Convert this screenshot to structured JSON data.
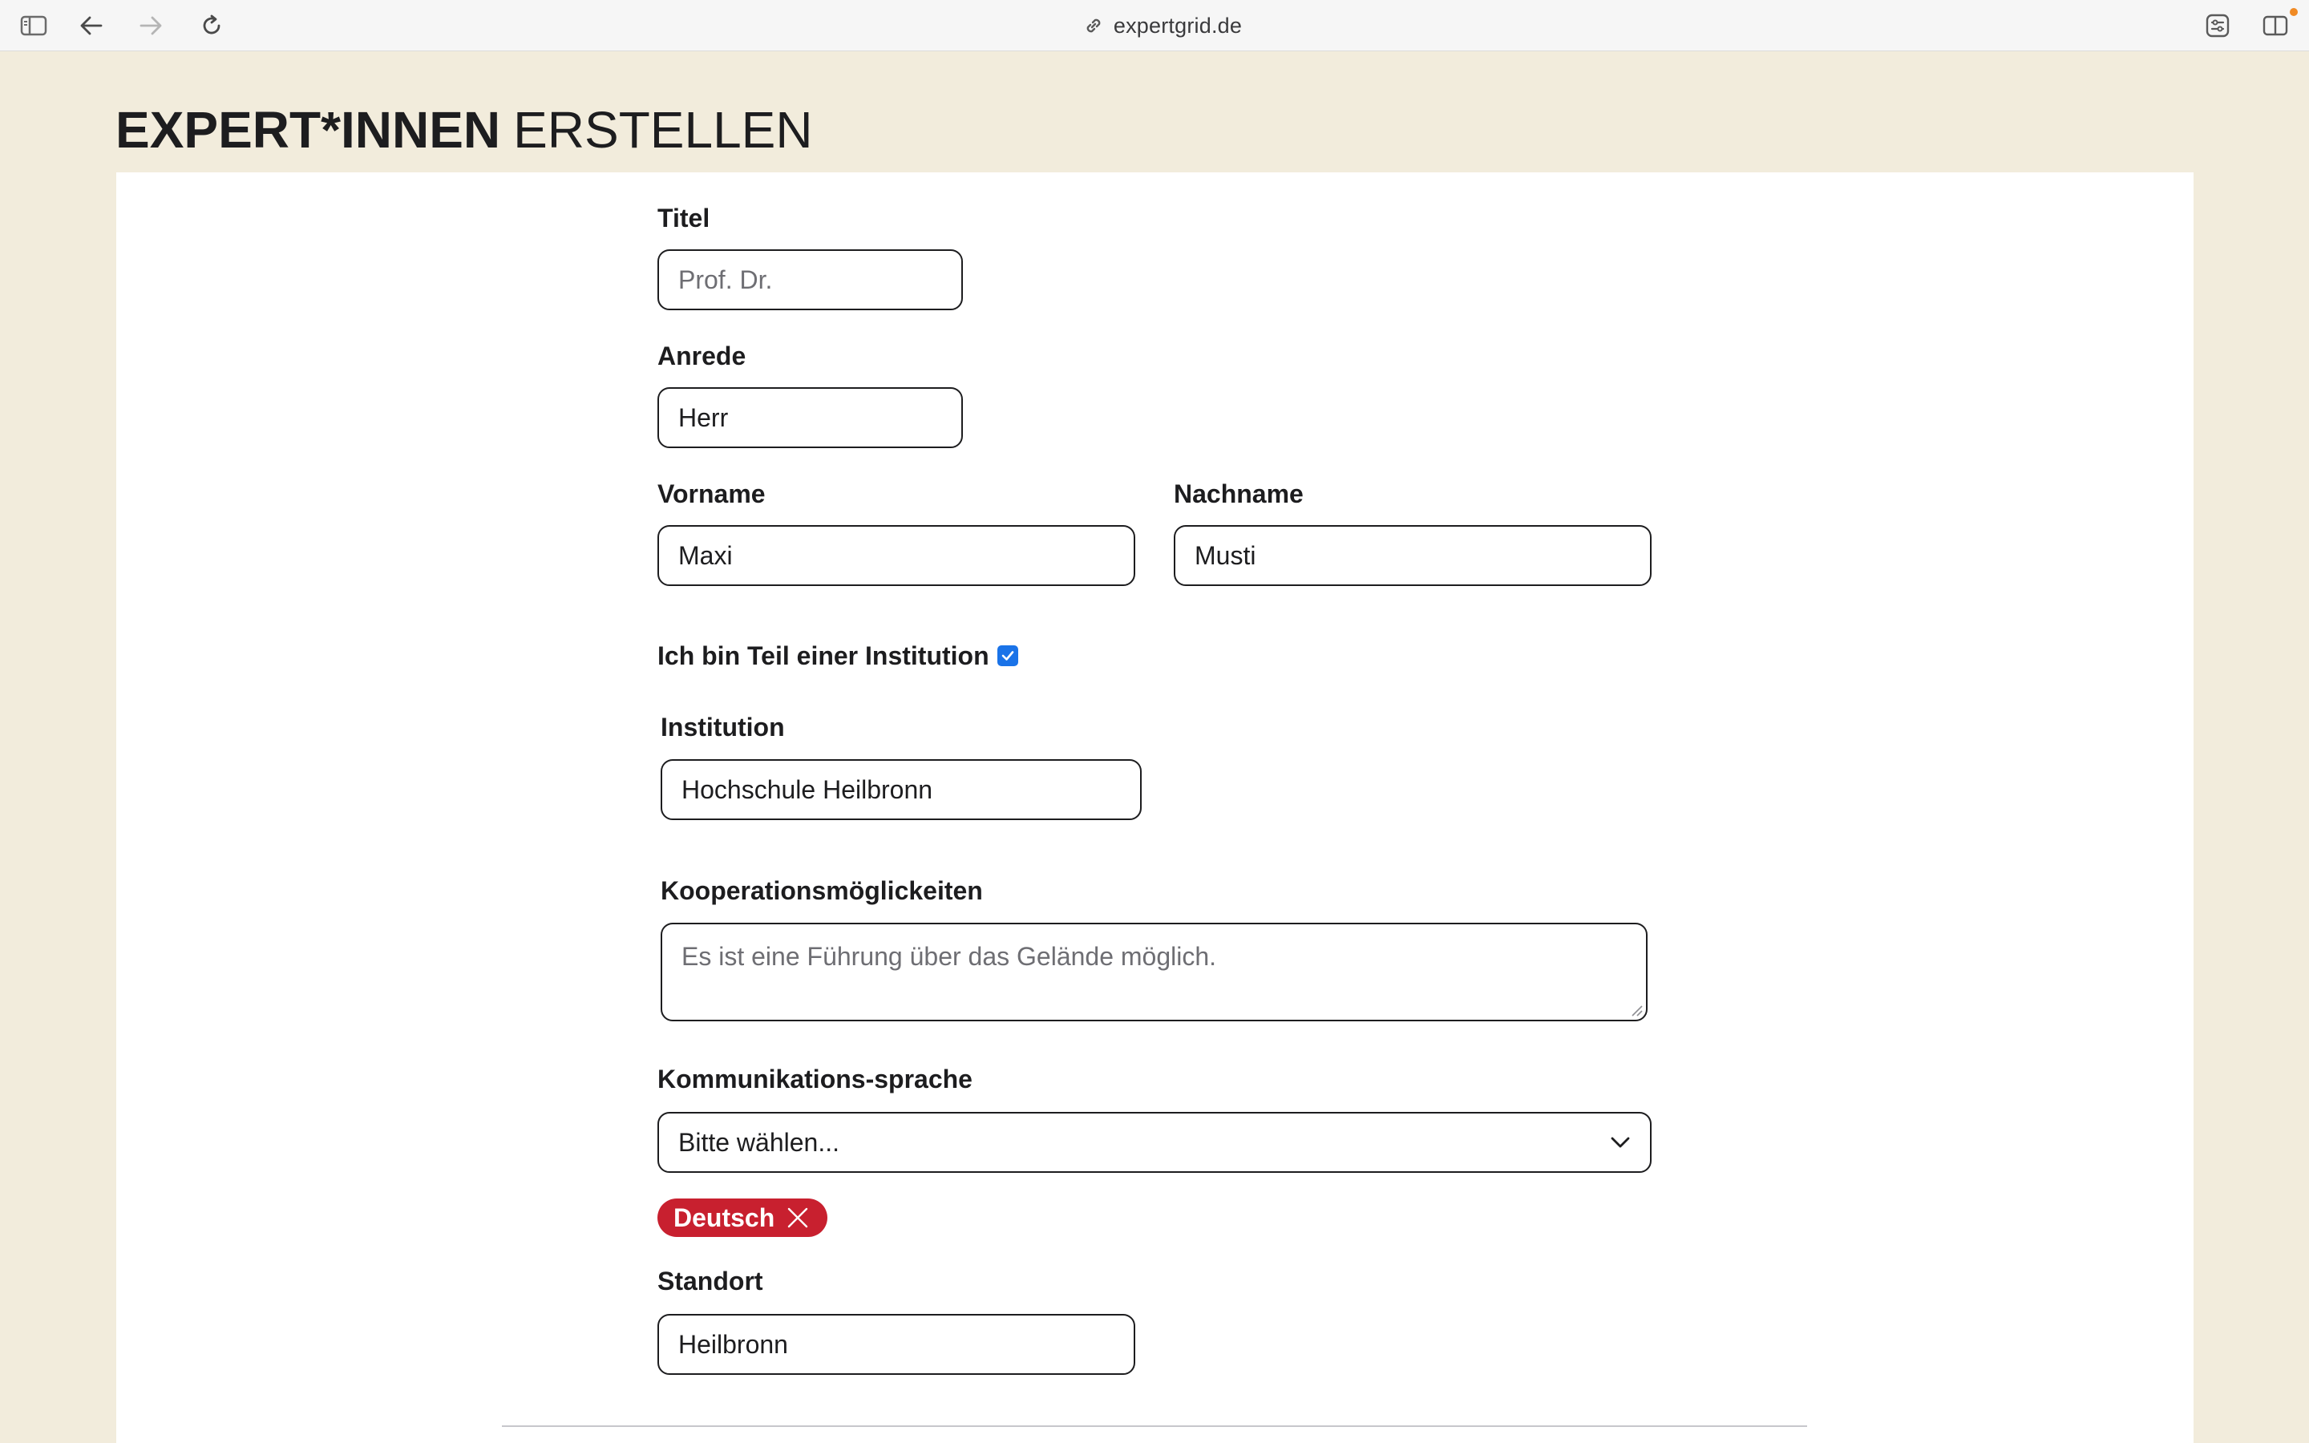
{
  "browser": {
    "url": "expertgrid.de"
  },
  "page": {
    "title_strong": "EXPERT*INNEN",
    "title_light": "ERSTELLEN"
  },
  "form": {
    "titel": {
      "label": "Titel",
      "placeholder": "Prof. Dr."
    },
    "anrede": {
      "label": "Anrede",
      "value": "Herr"
    },
    "vorname": {
      "label": "Vorname",
      "value": "Maxi"
    },
    "nachname": {
      "label": "Nachname",
      "value": "Musti"
    },
    "institution_checkbox": {
      "label": "Ich bin Teil einer Institution",
      "checked": true
    },
    "institution": {
      "label": "Institution",
      "value": "Hochschule Heilbronn"
    },
    "kooperation": {
      "label": "Kooperationsmöglickeiten",
      "placeholder": "Es ist eine Führung über das Gelände möglich."
    },
    "sprache": {
      "label": "Kommunikations-sprache",
      "selected": "Bitte wählen...",
      "tags": [
        "Deutsch"
      ]
    },
    "standort": {
      "label": "Standort",
      "value": "Heilbronn"
    }
  },
  "colors": {
    "page_background": "#f2ecdc",
    "card_background": "#ffffff",
    "tag_background": "#c8202f",
    "checkbox_accent": "#1a73e8"
  },
  "icons": [
    "sidebar-icon",
    "back-arrow-icon",
    "forward-arrow-icon",
    "reload-icon",
    "link-icon",
    "extensions-icon",
    "split-view-icon",
    "chevron-down-icon",
    "close-icon",
    "checkmark-icon"
  ]
}
